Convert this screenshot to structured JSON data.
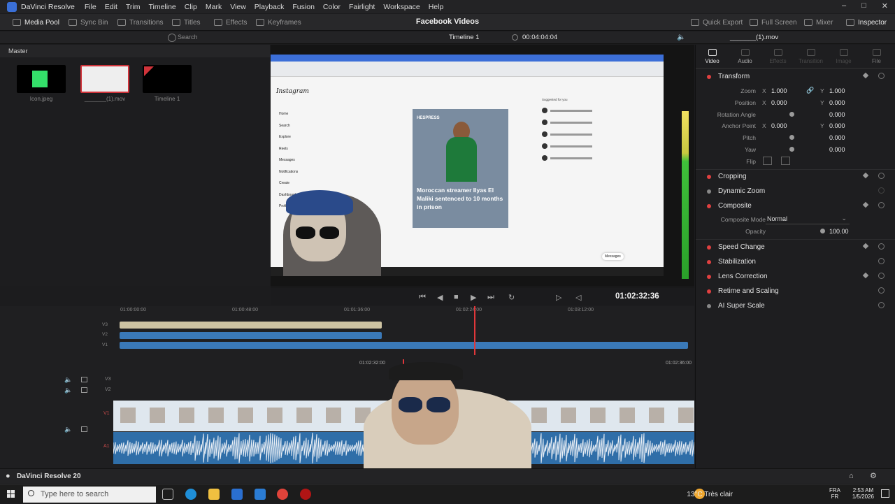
{
  "app": {
    "title": "DaVinci Resolve",
    "menu": [
      "File",
      "Edit",
      "Trim",
      "Timeline",
      "Clip",
      "Mark",
      "View",
      "Playback",
      "Fusion",
      "Color",
      "Fairlight",
      "Workspace",
      "Help"
    ]
  },
  "toolbar": {
    "media_pool": "Media Pool",
    "sync_bin": "Sync Bin",
    "transitions": "Transitions",
    "titles": "Titles",
    "effects": "Effects",
    "keyframes": "Keyframes",
    "center_title": "Facebook Videos",
    "quick_export": "Quick Export",
    "full_screen": "Full Screen",
    "mixer": "Mixer",
    "inspector": "Inspector"
  },
  "toolbar2": {
    "search_placeholder": "Search",
    "timeline_name": "Timeline 1",
    "duration": "00:04:04:04",
    "clip_name": "_______(1).mov"
  },
  "media_pool": {
    "bin": "Master",
    "clips": [
      {
        "name": "Icon.jpeg"
      },
      {
        "name": "_______(1).mov"
      },
      {
        "name": "Timeline 1"
      }
    ]
  },
  "viewer": {
    "site_name": "Instagram",
    "nav": [
      "Home",
      "Search",
      "Explore",
      "Reels",
      "Messages",
      "Notifications",
      "Create",
      "Dashboard",
      "Profile"
    ],
    "post_source": "HESPRESS",
    "post_headline": "Moroccan streamer Ilyas El Maliki sentenced to 10 months in prison",
    "suggested_label": "Suggested for you",
    "messages_label": "Messages"
  },
  "transport": {
    "timecode": "01:02:32:36"
  },
  "timeline": {
    "ruler_top": [
      "01:00:00:00",
      "01:00:48:00",
      "01:01:36:00",
      "01:02:24:00",
      "01:03:12:00"
    ],
    "ruler_bottom": [
      "01:02:32:00",
      "01:02:36:00"
    ],
    "tracks_top": [
      "V3",
      "V2",
      "V1"
    ],
    "tracks_bottom": [
      "V3",
      "V2",
      "V1",
      "A1"
    ]
  },
  "inspector": {
    "tabs": [
      "Video",
      "Audio",
      "Effects",
      "Transition",
      "Image",
      "File"
    ],
    "transform": {
      "label": "Transform",
      "zoom_label": "Zoom",
      "zoom_x": "1.000",
      "zoom_y": "1.000",
      "position_label": "Position",
      "pos_x": "0.000",
      "pos_y": "0.000",
      "rotation_label": "Rotation Angle",
      "rotation": "0.000",
      "anchor_label": "Anchor Point",
      "anchor_x": "0.000",
      "anchor_y": "0.000",
      "pitch_label": "Pitch",
      "pitch": "0.000",
      "yaw_label": "Yaw",
      "yaw": "0.000",
      "flip_label": "Flip",
      "x": "X",
      "y": "Y"
    },
    "sections": [
      "Cropping",
      "Dynamic Zoom",
      "Composite"
    ],
    "composite": {
      "mode_label": "Composite Mode",
      "mode": "Normal",
      "opacity_label": "Opacity",
      "opacity": "100.00"
    },
    "more_sections": [
      "Speed Change",
      "Stabilization",
      "Lens Correction",
      "Retime and Scaling",
      "AI Super Scale"
    ]
  },
  "statusbar": {
    "brand": "DaVinci Resolve 20"
  },
  "taskbar": {
    "search_placeholder": "Type here to search",
    "weather": "13°C  Très clair",
    "lang_top": "FRA",
    "lang_bottom": "FR",
    "time": "2:53 AM",
    "date": "1/5/2026"
  },
  "colors": {
    "accent_red": "#e0373a",
    "clip_blue": "#3a79b8",
    "clip_tan": "#cdc3a2"
  }
}
